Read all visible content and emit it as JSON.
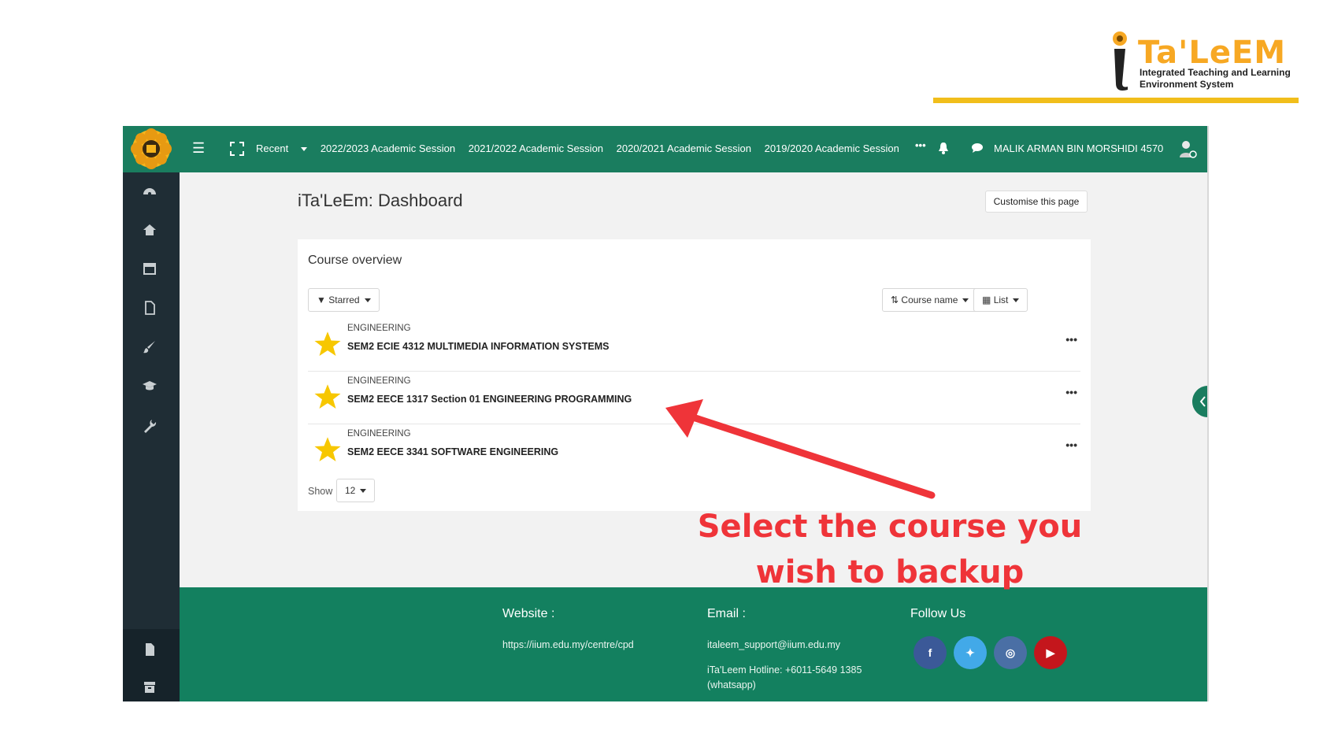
{
  "logo": {
    "title": "Ta'LeEM",
    "subtitle_line1": "Integrated Teaching and Learning",
    "subtitle_line2": "Environment System"
  },
  "navbar": {
    "recent_label": "Recent",
    "sessions": [
      "2022/2023 Academic Session",
      "2021/2022 Academic Session",
      "2020/2021 Academic Session",
      "2019/2020 Academic Session"
    ],
    "more_label": "•••",
    "user_name": "MALIK ARMAN BIN MORSHIDI 4570"
  },
  "sidebar": {
    "items": [
      "dashboard-icon",
      "home-icon",
      "calendar-icon",
      "file-icon",
      "brush-icon",
      "graduation-cap-icon",
      "wrench-icon"
    ],
    "bottom_items": [
      "document-icon",
      "archive-icon"
    ]
  },
  "page": {
    "title": "iTa'LeEm: Dashboard",
    "customise_label": "Customise this page"
  },
  "course_overview": {
    "title": "Course overview",
    "filter_label": "Starred",
    "sort_label": "Course name",
    "view_label": "List",
    "courses": [
      {
        "category": "ENGINEERING",
        "name": "SEM2 ECIE 4312 MULTIMEDIA INFORMATION SYSTEMS"
      },
      {
        "category": "ENGINEERING",
        "name": "SEM2 EECE 1317 Section 01 ENGINEERING PROGRAMMING"
      },
      {
        "category": "ENGINEERING",
        "name": "SEM2 EECE 3341 SOFTWARE ENGINEERING"
      }
    ],
    "row_menu": "•••",
    "show_label": "Show",
    "show_value": "12"
  },
  "footer": {
    "website_heading": "Website :",
    "website_url": "https://iium.edu.my/centre/cpd",
    "email_heading": "Email :",
    "email_value": "italeem_support@iium.edu.my",
    "hotline": "iTa'Leem Hotline: +6011-5649 1385",
    "hotline_note": "(whatsapp)",
    "follow_heading": "Follow Us",
    "social": [
      {
        "name": "facebook",
        "glyph": "f",
        "color": "#3b5998"
      },
      {
        "name": "twitter",
        "glyph": "✦",
        "color": "#42a9e8"
      },
      {
        "name": "instagram",
        "glyph": "◎",
        "color": "#4a6fa5"
      },
      {
        "name": "youtube",
        "glyph": "▶",
        "color": "#c4161c"
      }
    ]
  },
  "annotation": {
    "line1": "Select the course you",
    "line2": "wish to backup",
    "color": "#ef3439"
  },
  "colors": {
    "navbar": "#1a7d5f",
    "sidebar": "#1f2d35",
    "star": "#f7c700",
    "brand_orange": "#f7a823"
  }
}
